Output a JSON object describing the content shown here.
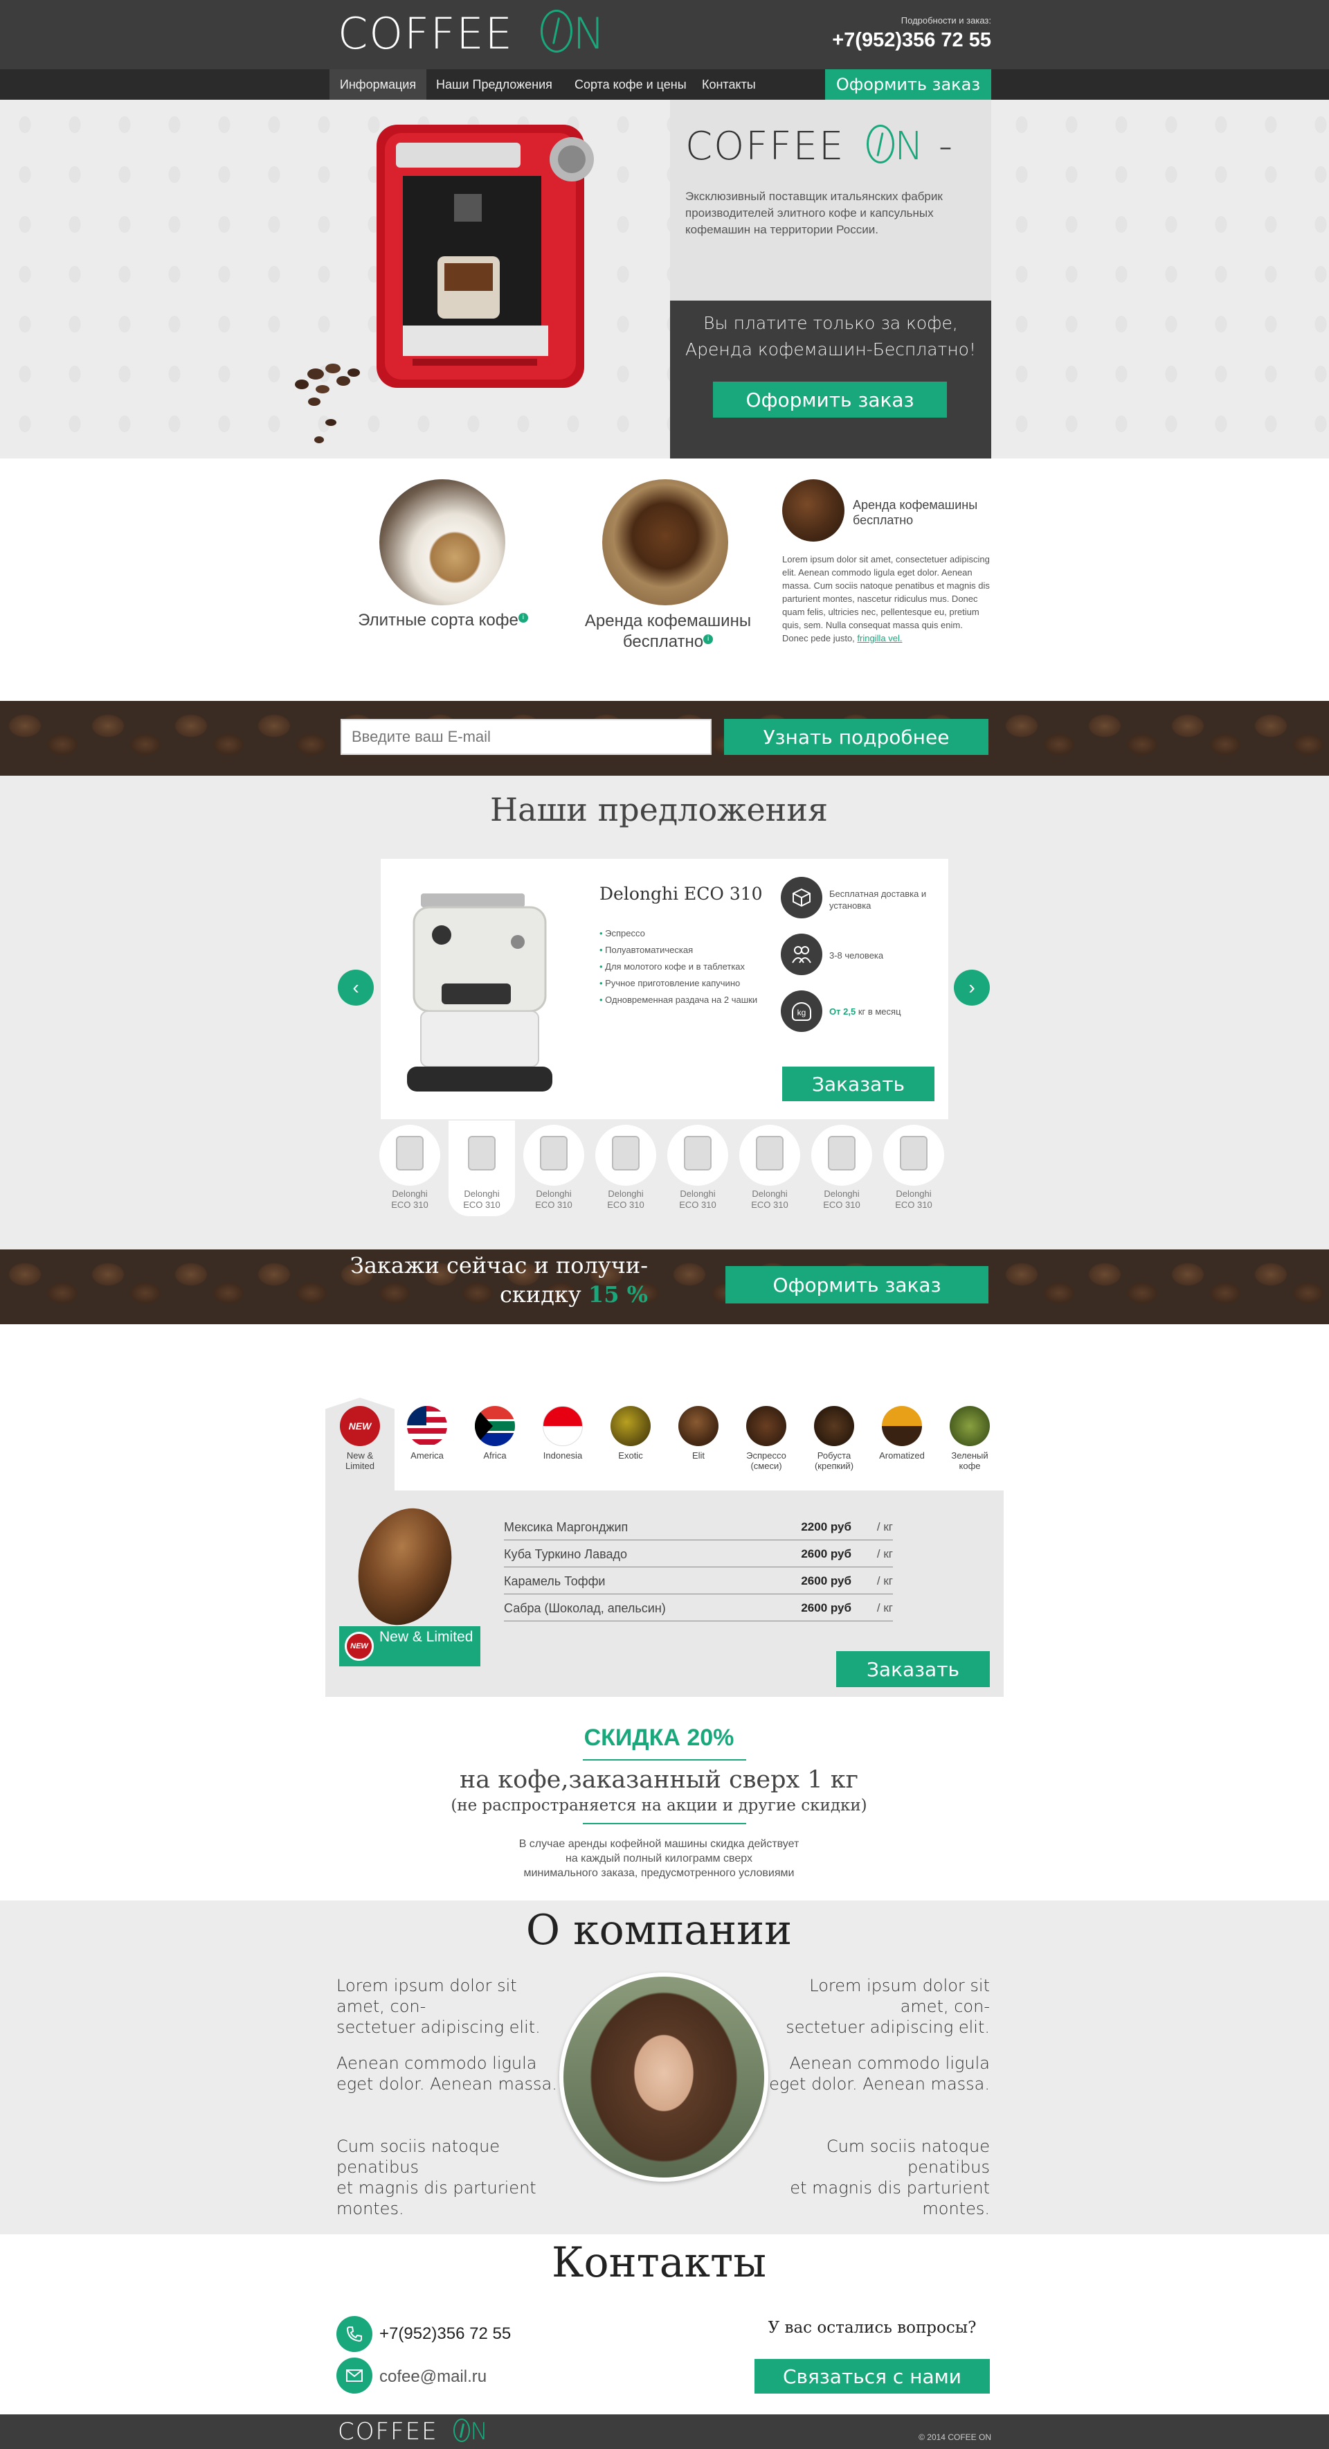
{
  "header": {
    "logo_text": "COFFEE",
    "logo_on": "N",
    "contact_caption": "Подробности и заказ:",
    "phone": "+7(952)356 72 55"
  },
  "nav": {
    "items": [
      {
        "label": "Информация"
      },
      {
        "label": "Наши Предложения"
      },
      {
        "label": "Сорта кофе и цены"
      },
      {
        "label": "Контакты"
      }
    ],
    "order_button": "Оформить заказ"
  },
  "hero": {
    "logo_text": "COFFEE",
    "logo_on": "N",
    "description": "Эксклюзивный поставщик итальянских фабрик производителей элитного кофе и капсульных кофемашин на территории России.",
    "promo_line1": "Вы платите только за кофе,",
    "promo_line2": "Аренда кофемашин-Бесплатно!",
    "order_button": "Оформить заказ"
  },
  "features": {
    "item1": "Элитные сорта кофе",
    "item2": "Аренда кофемашины бесплатно",
    "item3_title": "Аренда кофемашины бесплатно",
    "item3_text": "Lorem ipsum dolor sit amet, consectetuer adipiscing elit. Aenean commodo ligula eget dolor. Aenean massa. Cum sociis natoque penatibus et magnis dis parturient montes, nascetur ridiculus mus. Donec quam felis, ultricies nec, pellentesque eu, pretium quis, sem. Nulla consequat massa quis enim. Donec pede justo,",
    "item3_link": "fringilla vel."
  },
  "subscribe": {
    "email_placeholder": "Введите ваш E-mail",
    "button": "Узнать подробнее"
  },
  "offers": {
    "title": "Наши предложения",
    "product_name": "Delonghi ECO 310",
    "bullets": [
      "Эспрессо",
      "Полуавтоматическая",
      "Для молотого кофе и в таблетках",
      "Ручное приготовление капучино",
      "Одновременная раздача на 2 чашки"
    ],
    "perk1": "Бесплатная доставка и установка",
    "perk2": "3-8 человека",
    "perk3_prefix": "От",
    "perk3_value": "2,5",
    "perk3_suffix": "кг в месяц",
    "perk3_icon": "kg",
    "order_button": "Заказать",
    "thumbs": [
      {
        "line1": "Delonghi",
        "line2": "ECO 310"
      },
      {
        "line1": "Delonghi",
        "line2": "ECO 310"
      },
      {
        "line1": "Delonghi",
        "line2": "ECO 310"
      },
      {
        "line1": "Delonghi",
        "line2": "ECO 310"
      },
      {
        "line1": "Delonghi",
        "line2": "ECO 310"
      },
      {
        "line1": "Delonghi",
        "line2": "ECO 310"
      },
      {
        "line1": "Delonghi",
        "line2": "ECO 310"
      },
      {
        "line1": "Delonghi",
        "line2": "ECO 310"
      }
    ]
  },
  "discount_banner": {
    "line1": "Закажи сейчас и получи-",
    "line2": "скидку",
    "percent": "15 %",
    "button": "Оформить заказ"
  },
  "varieties": {
    "new_badge": "NEW",
    "tabs": [
      {
        "line1": "New &",
        "line2": "Limited"
      },
      {
        "line1": "America",
        "line2": ""
      },
      {
        "line1": "Africa",
        "line2": ""
      },
      {
        "line1": "Indonesia",
        "line2": ""
      },
      {
        "line1": "Exotic",
        "line2": ""
      },
      {
        "line1": "Elit",
        "line2": ""
      },
      {
        "line1": "Эспрессо",
        "line2": "(смеси)"
      },
      {
        "line1": "Робуста",
        "line2": "(крепкий)"
      },
      {
        "line1": "Aromatized",
        "line2": ""
      },
      {
        "line1": "Зеленый",
        "line2": "кофе"
      }
    ],
    "label": "New & Limited",
    "rows": [
      {
        "name": "Мексика Маргонджип",
        "price": "2200 руб",
        "unit": "/ кг"
      },
      {
        "name": "Куба Туркино Лавадо",
        "price": "2600 руб",
        "unit": "/ кг"
      },
      {
        "name": "Карамель Тоффи",
        "price": "2600 руб",
        "unit": "/ кг"
      },
      {
        "name": "Сабра (Шоколад, апельсин)",
        "price": "2600 руб",
        "unit": "/ кг"
      }
    ],
    "order_button": "Заказать"
  },
  "sale": {
    "title": "СКИДКА 20%",
    "line1": "на кофе,заказанный сверх 1 кг",
    "line2": "(не распространяется на акции и другие скидки)",
    "note1": "В случае аренды кофейной машины скидка действует",
    "note2": "на каждый полный килограмм сверх",
    "note3": "минимального заказа, предусмотренного условиями"
  },
  "about": {
    "title": "О компании",
    "left": [
      {
        "l1": "Lorem ipsum dolor sit amet, con-",
        "l2": "sectetuer adipiscing elit."
      },
      {
        "l1": "Aenean commodo ligula",
        "l2": "eget dolor. Aenean massa."
      },
      {
        "l1": "Cum sociis natoque penatibus",
        "l2": "et magnis dis parturient montes."
      }
    ],
    "right": [
      {
        "l1": "Lorem ipsum dolor sit amet, con-",
        "l2": "sectetuer adipiscing elit."
      },
      {
        "l1": "Aenean commodo ligula",
        "l2": "eget dolor. Aenean massa."
      },
      {
        "l1": "Cum sociis natoque penatibus",
        "l2": "et magnis dis parturient montes."
      }
    ]
  },
  "contacts": {
    "title": "Контакты",
    "phone": "+7(952)356 72 55",
    "email": "cofee@mail.ru",
    "question": "У вас остались вопросы?",
    "button": "Связаться с нами"
  },
  "footer": {
    "logo_text": "COFFEE",
    "logo_on": "N",
    "copyright": "© 2014 COFEE ON"
  },
  "colors": {
    "accent": "#19a87c",
    "dark": "#3d3d3d",
    "light": "#ececec"
  }
}
